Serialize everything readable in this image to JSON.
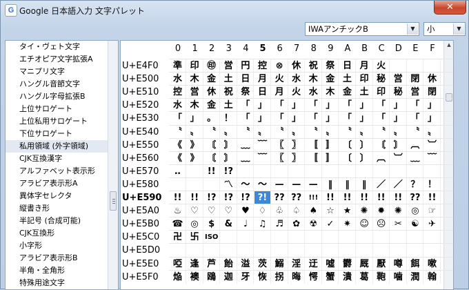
{
  "window": {
    "title": "Google 日本語入力 文字パレット",
    "icon": "google-g-icon",
    "icon_glyph": "G",
    "close_label": "✕"
  },
  "toolbar": {
    "font_select": "IWAアンチックB",
    "size_select": "小"
  },
  "categories": [
    {
      "label": "タイ・ヴェト文字"
    },
    {
      "label": "エチオピア文字拡張A"
    },
    {
      "label": "マニプリ文字"
    },
    {
      "label": "ハングル音節文字"
    },
    {
      "label": "ハングル字母拡張B"
    },
    {
      "label": "上位サロゲート"
    },
    {
      "label": "上位私用サロゲート"
    },
    {
      "label": "下位サロゲート"
    },
    {
      "label": "私用領域 (外字領域)",
      "selected": true
    },
    {
      "label": "CJK互換漢字"
    },
    {
      "label": "アルファベット表示形"
    },
    {
      "label": "アラビア表示形A"
    },
    {
      "label": "異体字セレクタ"
    },
    {
      "label": "縦書き形"
    },
    {
      "label": "半記号 (合成可能)"
    },
    {
      "label": "CJK互換形"
    },
    {
      "label": "小字形"
    },
    {
      "label": "アラビア表示形B"
    },
    {
      "label": "半角・全角形"
    },
    {
      "label": "特殊用途文字"
    }
  ],
  "grid": {
    "columns": [
      "0",
      "1",
      "2",
      "3",
      "4",
      "5",
      "6",
      "7",
      "8",
      "9",
      "A",
      "B",
      "C",
      "D",
      "E",
      "F"
    ],
    "bold_column": "5",
    "rows": [
      {
        "label": "U+E4F0",
        "chars": [
          "準",
          "印",
          "㊞",
          "営",
          "円",
          "控",
          "⊗",
          "休",
          "祝",
          "祭",
          "日",
          "月",
          "火",
          "",
          "",
          ""
        ]
      },
      {
        "label": "U+E500",
        "chars": [
          "水",
          "木",
          "金",
          "土",
          "日",
          "月",
          "火",
          "水",
          "木",
          "金",
          "土",
          "印",
          "秘",
          "営",
          "閉",
          "休"
        ]
      },
      {
        "label": "U+E510",
        "chars": [
          "控",
          "営",
          "休",
          "祝",
          "祭",
          "日",
          "月",
          "火",
          "水",
          "木",
          "金",
          "土",
          "印",
          "秘",
          "営",
          "閉"
        ]
      },
      {
        "label": "U+E520",
        "chars": [
          "水",
          "木",
          "金",
          "土",
          "「",
          "」",
          "「",
          "」",
          "「",
          "」",
          "「",
          "」",
          "「",
          "」",
          "「",
          "」"
        ]
      },
      {
        "label": "U+E530",
        "chars": [
          "「",
          "」",
          "。",
          "！",
          "「",
          "」",
          "「",
          "」",
          "「",
          "」",
          "「",
          "」",
          "「",
          "」",
          "「",
          "」"
        ]
      },
      {
        "label": "U+E540",
        "chars": [
          "〝",
          "〟",
          "〝",
          "〟",
          "〝",
          "〟",
          "〝",
          "〟",
          "〝",
          "〟",
          "〝",
          "〟",
          "〝",
          "〟",
          "〝",
          "〟"
        ]
      },
      {
        "label": "U+E550",
        "chars": [
          "《",
          "》",
          "〘",
          "〙",
          "﹏",
          "﹋",
          "〖",
          "〗",
          "〚",
          "〛",
          "〔",
          "〕",
          "〘",
          "〙",
          "︹",
          "︺"
        ]
      },
      {
        "label": "U+E560",
        "chars": [
          "《",
          "》",
          "〘",
          "〙",
          "﹏",
          "﹋",
          "〖",
          "〗",
          "〚",
          "〛",
          "〔",
          "〕",
          "︹",
          "︺",
          "﹏",
          "﹋"
        ]
      },
      {
        "label": "U+E570",
        "chars": [
          "‥",
          "",
          "!!",
          "!?",
          "",
          "",
          "",
          "",
          "",
          "",
          "",
          "",
          "",
          "",
          "",
          ""
        ]
      },
      {
        "label": "U+E580",
        "chars": [
          "",
          "",
          "",
          "〽",
          "〜",
          "〜",
          "—",
          "—",
          "—",
          "‖",
          "‖",
          "‖",
          "／",
          "／",
          "？",
          "！"
        ]
      },
      {
        "label": "U+E590",
        "chars": [
          "!!",
          "!!",
          "!?",
          "!?",
          "!?",
          "?!",
          "??",
          "??",
          "!!!",
          "!!",
          "!!",
          "!!",
          "!!",
          "!!",
          "??",
          "!!"
        ]
      },
      {
        "label": "U+E5A0",
        "chars": [
          "♨",
          "♡",
          "♡",
          "♡",
          "♥",
          "♢",
          "♧",
          "♤",
          "♠",
          "☆",
          "★",
          "✺",
          "✹",
          "✺",
          "◎",
          "☞"
        ]
      },
      {
        "label": "U+E5B0",
        "chars": [
          "☎",
          "◎",
          "$",
          "&",
          "♩",
          "♫",
          "♬",
          "✿",
          "☢",
          "✓",
          "✷",
          "☺",
          "☹",
          "✂",
          "☯",
          "✈"
        ]
      },
      {
        "label": "U+E5C0",
        "chars": [
          "卍",
          "卐",
          "ISO",
          "",
          "",
          "",
          "",
          "",
          "",
          "",
          "",
          "",
          "",
          "",
          "",
          ""
        ]
      },
      {
        "label": "U+E5D0",
        "chars": [
          "",
          "",
          "",
          "",
          "",
          "",
          "",
          "",
          "",
          "",
          "",
          "",
          "",
          "",
          "",
          ""
        ]
      },
      {
        "label": "U+E5E0",
        "chars": [
          "啞",
          "逢",
          "芦",
          "飴",
          "溢",
          "茨",
          "鰯",
          "淫",
          "迂",
          "噓",
          "欝",
          "厩",
          "厭",
          "噂",
          "餌",
          "嗽"
        ]
      },
      {
        "label": "U+E5F0",
        "chars": [
          "焔",
          "襖",
          "鴎",
          "迦",
          "牙",
          "恢",
          "拐",
          "晦",
          "愕",
          "蟹",
          "潰",
          "葛",
          "鞄",
          "噛",
          "潤",
          "翰"
        ]
      }
    ],
    "highlight": {
      "row": "U+E590",
      "col": "5"
    }
  }
}
